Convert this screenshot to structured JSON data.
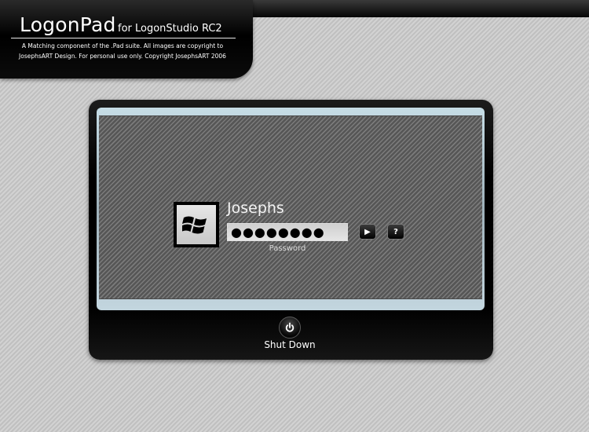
{
  "header": {
    "title": "LogonPad",
    "subtitle": "for LogonStudio RC2",
    "description": "A Matching component of the .Pad suite. All images are copyright to JosephsART Design. For personal use only. Copyright JosephsART 2006"
  },
  "logon": {
    "user_name": "Josephs",
    "password_value": "●●●●●●●●",
    "password_hint": "Password",
    "go_label": "▶",
    "help_label": "?",
    "user_icon": "windows-flag-icon"
  },
  "footer": {
    "shutdown_label": "Shut Down",
    "shutdown_icon": "power-icon"
  },
  "colors": {
    "background": "#c9c9c9",
    "window": "#000000",
    "pane_border": "#c6dde6",
    "pane_fill": "#6c6c6c"
  }
}
